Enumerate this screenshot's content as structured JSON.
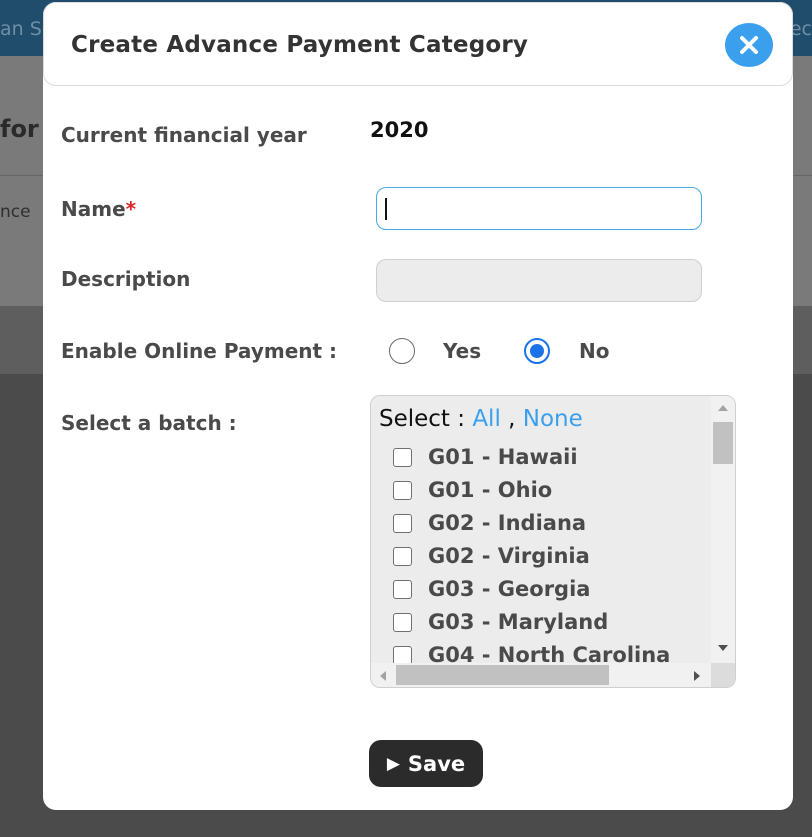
{
  "background": {
    "topbar_left_text": "an Sc",
    "topbar_right_text": "ec",
    "heading_fragment": "for",
    "sub_fragment": "nce"
  },
  "modal": {
    "title": "Create Advance Payment Category",
    "close_icon": "close-icon",
    "accent_color": "#3aa0ee",
    "fields": {
      "financial_year_label": "Current financial year",
      "financial_year_value": "2020",
      "name_label": "Name",
      "name_required_mark": "*",
      "name_value": "",
      "description_label": "Description",
      "description_value": "",
      "online_payment_label": "Enable Online Payment :",
      "online_payment_options": [
        "Yes",
        "No"
      ],
      "online_payment_selected": "No",
      "batch_label": "Select a batch :"
    },
    "batch": {
      "select_prefix": "Select :",
      "select_all": "All",
      "select_separator": ",",
      "select_none": "None",
      "items": [
        "G01 - Hawaii",
        "G01 - Ohio",
        "G02 - Indiana",
        "G02 - Virginia",
        "G03 - Georgia",
        "G03 - Maryland",
        "G04 - North Carolina"
      ]
    },
    "save_label": "Save",
    "save_icon": "play-icon"
  }
}
